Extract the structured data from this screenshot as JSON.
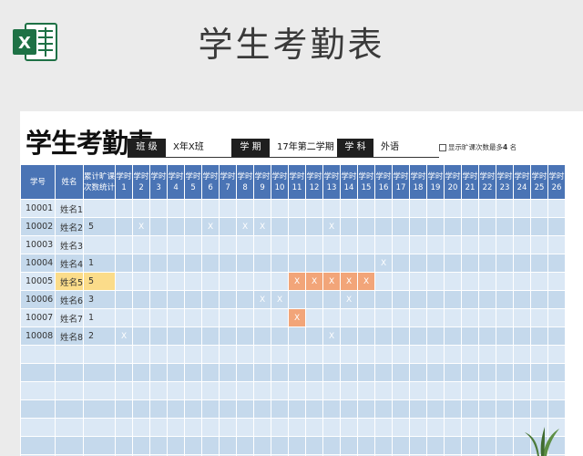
{
  "banner": {
    "title": "学生考勤表",
    "icon": "excel-icon"
  },
  "sheet": {
    "title": "学生考勤表",
    "fields": [
      {
        "label": "班 级",
        "value": "X年X班"
      },
      {
        "label": "学 期",
        "value": "17年第二学期"
      },
      {
        "label": "学 科",
        "value": "外语"
      }
    ],
    "option": {
      "text_before": "显示旷课次数最多",
      "number": "4",
      "text_after": "名"
    }
  },
  "table": {
    "headers": {
      "id": "学号",
      "name": "姓名",
      "total": [
        "累计旷课",
        "次数统计"
      ],
      "period_prefix": "学时"
    },
    "periods": [
      "1",
      "2",
      "3",
      "4",
      "5",
      "6",
      "7",
      "8",
      "9",
      "10",
      "11",
      "12",
      "13",
      "14",
      "15",
      "16",
      "17",
      "18",
      "19",
      "20",
      "21",
      "22",
      "23",
      "24",
      "25",
      "26"
    ],
    "mark": "X",
    "rows": [
      {
        "id": "10001",
        "name": "姓名1",
        "total": "",
        "marks": [],
        "highlight": false
      },
      {
        "id": "10002",
        "name": "姓名2",
        "total": "5",
        "marks": [
          2,
          6,
          8,
          9,
          13
        ],
        "highlight": true
      },
      {
        "id": "10003",
        "name": "姓名3",
        "total": "",
        "marks": [],
        "highlight": false
      },
      {
        "id": "10004",
        "name": "姓名4",
        "total": "1",
        "marks": [
          16
        ],
        "highlight": false
      },
      {
        "id": "10005",
        "name": "姓名5",
        "total": "5",
        "marks": [
          11,
          12,
          13,
          14,
          15
        ],
        "highlight": true
      },
      {
        "id": "10006",
        "name": "姓名6",
        "total": "3",
        "marks": [
          9,
          10,
          14
        ],
        "highlight": true
      },
      {
        "id": "10007",
        "name": "姓名7",
        "total": "1",
        "marks": [
          11
        ],
        "highlight": false
      },
      {
        "id": "10008",
        "name": "姓名8",
        "total": "2",
        "marks": [
          1,
          13
        ],
        "highlight": true
      }
    ],
    "empty_rows": 7
  },
  "colors": {
    "header": "#4a74b5",
    "row_light": "#dbe8f5",
    "row_dark": "#c5d9ec",
    "highlight": "#fbdc8a",
    "mark": "#f2a579"
  }
}
